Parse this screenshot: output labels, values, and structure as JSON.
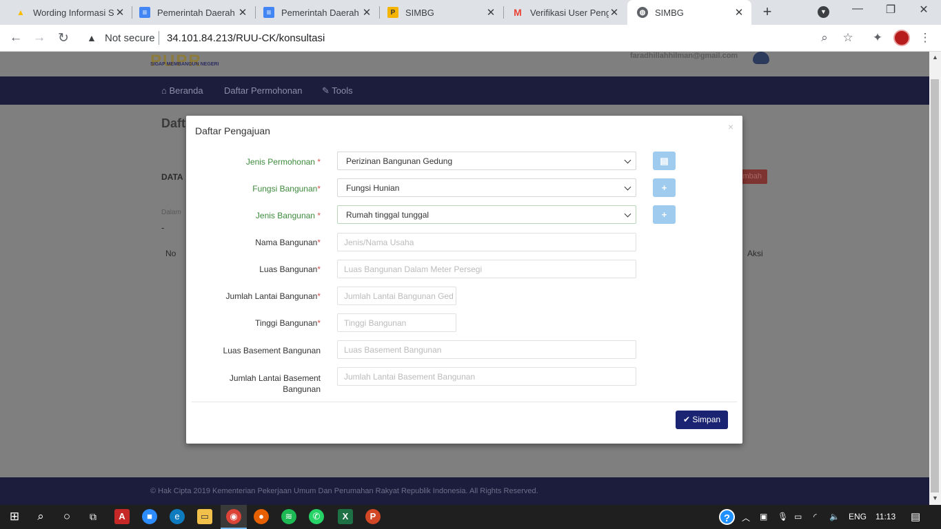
{
  "browser": {
    "tabs": [
      {
        "title": "Wording Informasi S",
        "icon": "google-drive-icon"
      },
      {
        "title": "Pemerintah Daerah",
        "icon": "google-docs-icon"
      },
      {
        "title": "Pemerintah Daerah",
        "icon": "google-docs-icon"
      },
      {
        "title": "SIMBG",
        "icon": "pupr-icon"
      },
      {
        "title": "Verifikasi User Peng",
        "icon": "gmail-icon"
      },
      {
        "title": "SIMBG",
        "icon": "globe-icon",
        "active": true
      }
    ],
    "security_label": "Not secure",
    "url": "34.101.84.213/RUU-CK/konsultasi"
  },
  "site": {
    "logo": "PUPR",
    "logo_tagline": "SIGAP MEMBANGUN NEGERI",
    "user_email": "faradhillahhilman@gmail.com",
    "nav": [
      "Beranda",
      "Daftar Permohonan",
      "Tools"
    ],
    "page_title": "Daft",
    "data_label": "DATA",
    "dalam_label": "Dalam",
    "dash": "-",
    "col_no": "No",
    "col_aksi": "Aksi",
    "tambah_label": "mbah",
    "footer": "© Hak Cipta 2019 Kementerian Pekerjaan Umum Dan Perumahan Rakyat Republik Indonesia. All Rights Reserved."
  },
  "modal": {
    "title": "Daftar Pengajuan",
    "close": "×",
    "fields": {
      "jenis_permohonan": {
        "label": "Jenis Permohonan",
        "value": "Perizinan Bangunan Gedung"
      },
      "fungsi_bangunan": {
        "label": "Fungsi Bangunan",
        "value": "Fungsi Hunian"
      },
      "jenis_bangunan": {
        "label": "Jenis Bangunan",
        "value": "Rumah tinggal tunggal"
      },
      "nama_bangunan": {
        "label": "Nama Bangunan",
        "placeholder": "Jenis/Nama Usaha"
      },
      "luas_bangunan": {
        "label": "Luas Bangunan",
        "placeholder": "Luas Bangunan Dalam Meter Persegi"
      },
      "jumlah_lantai": {
        "label": "Jumlah Lantai Bangunan",
        "placeholder": "Jumlah Lantai Bangunan Ged"
      },
      "tinggi_bangunan": {
        "label": "Tinggi Bangunan",
        "placeholder": "Tinggi Bangunan"
      },
      "luas_basement": {
        "label": "Luas Basement Bangunan",
        "placeholder": "Luas Basement Bangunan"
      },
      "jumlah_lantai_basement": {
        "label_line1": "Jumlah Lantai Basement",
        "label_line2": "Bangunan",
        "placeholder": "Jumlah Lantai Basement Bangunan"
      }
    },
    "required_mark": "*",
    "submit_label": "Simpan"
  },
  "taskbar": {
    "lang": "ENG",
    "time": "11:13"
  }
}
